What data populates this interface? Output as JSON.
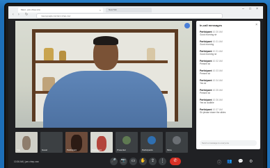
{
  "browser": {
    "tab1": "Meet - jom-vhep-xxw",
    "tab2": "New Tab",
    "address": "meet.google.com/jom-vhep-xxw",
    "ctrl_min": "–",
    "ctrl_max": "□",
    "ctrl_close": "×",
    "nav_back": "‹",
    "nav_fwd": "›",
    "nav_reload": "↻"
  },
  "chat": {
    "title": "In-call messages",
    "close": "×",
    "messages": [
      {
        "name": "Participant",
        "time": "10:30 AM",
        "text": "Good morning sir"
      },
      {
        "name": "Participant",
        "time": "10:31 AM",
        "text": "Good morning"
      },
      {
        "name": "Participant",
        "time": "10:31 AM",
        "text": "Good morning sir"
      },
      {
        "name": "Participant",
        "time": "10:32 AM",
        "text": "Present sir"
      },
      {
        "name": "Participant",
        "time": "10:33 AM",
        "text": "Present sir"
      },
      {
        "name": "Participant",
        "time": "10:34 AM",
        "text": "Yes sir"
      },
      {
        "name": "Participant",
        "time": "10:35 AM",
        "text": "Present sir"
      },
      {
        "name": "Participant",
        "time": "10:36 AM",
        "text": "Yes sir audible"
      },
      {
        "name": "Participant",
        "time": "10:37 AM",
        "text": "Sir please share the slides"
      }
    ],
    "input_placeholder": "Send a message to everyone"
  },
  "filmstrip": [
    {
      "label": "You"
    },
    {
      "label": "Guest"
    },
    {
      "label": "Participant"
    },
    {
      "label": "Participant"
    },
    {
      "label": "Presenter"
    },
    {
      "label": "Participants"
    },
    {
      "label": "More"
    }
  ],
  "controls": {
    "meeting_info": "10:36 AM | jom-vhep-xxw",
    "mic": "🎤",
    "cam": "📷",
    "cc": "▭",
    "hand": "✋",
    "present": "⇪",
    "more": "⋮",
    "end": "✆",
    "info": "ⓘ",
    "people": "👥",
    "chat": "💬",
    "activities": "⚙"
  },
  "colors": {
    "backdrop": "#1d6fb8",
    "meet_bg": "#202124",
    "end_call": "#d93025"
  }
}
